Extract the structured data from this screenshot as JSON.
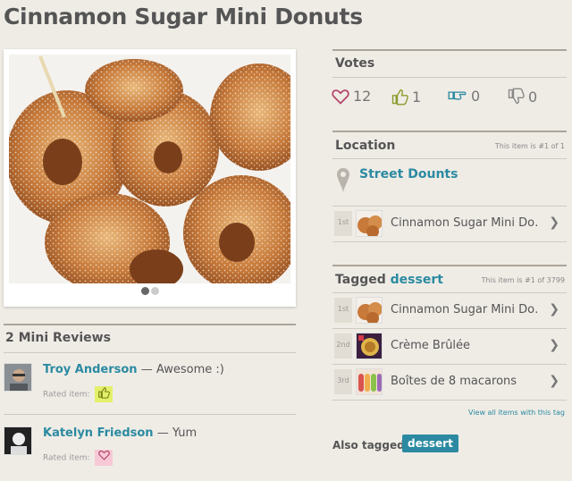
{
  "page_title": "Cinnamon Sugar Mini Donuts",
  "gallery": {
    "dot_count": 2,
    "active_dot": 0
  },
  "reviews": {
    "title": "2 Mini Reviews",
    "items": [
      {
        "name": "Troy Anderson",
        "separator": "—",
        "text": "Awesome :)",
        "rated_label": "Rated item:",
        "rating_icon": "thumbs-up-icon",
        "badge_color": "#e4f06a"
      },
      {
        "name": "Katelyn Friedson",
        "separator": "—",
        "text": "Yum",
        "rated_label": "Rated item:",
        "rating_icon": "heart-icon",
        "badge_color": "#f7c9d6"
      }
    ]
  },
  "votes": {
    "title": "Votes",
    "items": [
      {
        "icon": "heart-icon",
        "count": "12",
        "color": "#b5456a"
      },
      {
        "icon": "thumbs-up-icon",
        "count": "1",
        "color": "#8a9b2a"
      },
      {
        "icon": "thumbs-sideways-icon",
        "count": "0",
        "color": "#2b8aa1"
      },
      {
        "icon": "thumbs-down-icon",
        "count": "0",
        "color": "#888888"
      }
    ]
  },
  "location": {
    "title": "Location",
    "note": "This item is #1 of 1",
    "name": "Street Dounts",
    "items": [
      {
        "rank": "1st",
        "name": "Cinnamon Sugar Mini Do…"
      }
    ]
  },
  "tagged": {
    "title_prefix": "Tagged",
    "tag": "dessert",
    "note": "This item is #1 of 3799",
    "items": [
      {
        "rank": "1st",
        "name": "Cinnamon Sugar Mini Do…"
      },
      {
        "rank": "2nd",
        "name": "Crème Brûlée"
      },
      {
        "rank": "3rd",
        "name": "Boîtes de 8 macarons"
      }
    ],
    "view_all": "View all items with this tag"
  },
  "also_tagged": {
    "label": "Also tagged:",
    "tags": [
      "dessert"
    ]
  },
  "colors": {
    "accent": "#2b8aa1",
    "background": "#efece6"
  }
}
